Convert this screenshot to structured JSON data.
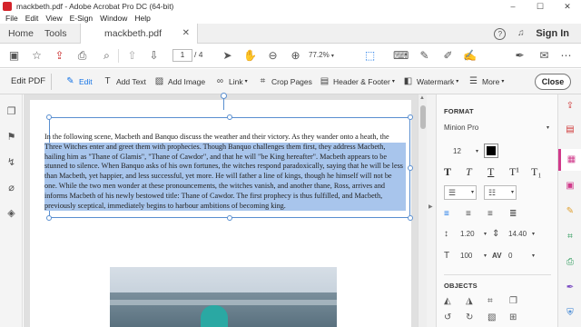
{
  "window": {
    "title": "mackbeth.pdf - Adobe Acrobat Pro DC (64-bit)",
    "controls": [
      "–",
      "☐",
      "✕"
    ]
  },
  "menu": [
    "File",
    "Edit",
    "View",
    "E-Sign",
    "Window",
    "Help"
  ],
  "tabs": {
    "home": "Home",
    "tools": "Tools",
    "document": "mackbeth.pdf",
    "help_glyph": "?",
    "bell_glyph": "🔔",
    "sign_in": "Sign In"
  },
  "toolbar": {
    "current_page": "1",
    "total_pages": "/ 4",
    "zoom": "77.2%"
  },
  "edit_pdf": {
    "label": "Edit PDF",
    "edit": "Edit",
    "add_text": "Add Text",
    "add_image": "Add Image",
    "link": "Link",
    "crop_pages": "Crop Pages",
    "header_footer": "Header & Footer",
    "watermark": "Watermark",
    "more": "More",
    "close": "Close",
    "accent_color": "#1473e6"
  },
  "document": {
    "paragraph_lines": [
      "In the following scene, Macbeth and Banquo discuss the weather and their victory. As they wander onto a heath, the",
      "Three Witches enter and greet them with prophecies. Though Banquo challenges them first, they address Macbeth,",
      "hailing him as \"Thane of Glamis\", \"Thane of Cawdor\", and that he will \"be King hereafter\". Macbeth appears to be",
      "stunned to silence. When Banquo asks of his own fortunes, the witches respond paradoxically, saying that he will be less",
      "than Macbeth, yet happier, and less successful, yet more. He will father a line of kings, though he himself will not be",
      "one. While the two men wonder at these pronouncements, the witches vanish, and another thane, Ross, arrives and",
      "informs Macbeth of his newly bestowed title: Thane of Cawdor. The first prophecy is thus fulfilled, and Macbeth,",
      "previously sceptical, immediately begins to harbour ambitions of becoming king."
    ],
    "selection_color": "#a8c5ec"
  },
  "format_panel": {
    "format_heading": "FORMAT",
    "font": "Minion Pro",
    "size": "12",
    "text_color": "#000000",
    "styles": [
      "T",
      "T",
      "T",
      "T¹",
      "T₁"
    ],
    "line_spacing": "1.20",
    "paragraph_spacing": "14.40",
    "horizontal_scale": "100",
    "char_spacing_label": "AV",
    "char_spacing": "0",
    "objects_heading": "OBJECTS"
  },
  "right_rail_accent": "#d03a8b"
}
